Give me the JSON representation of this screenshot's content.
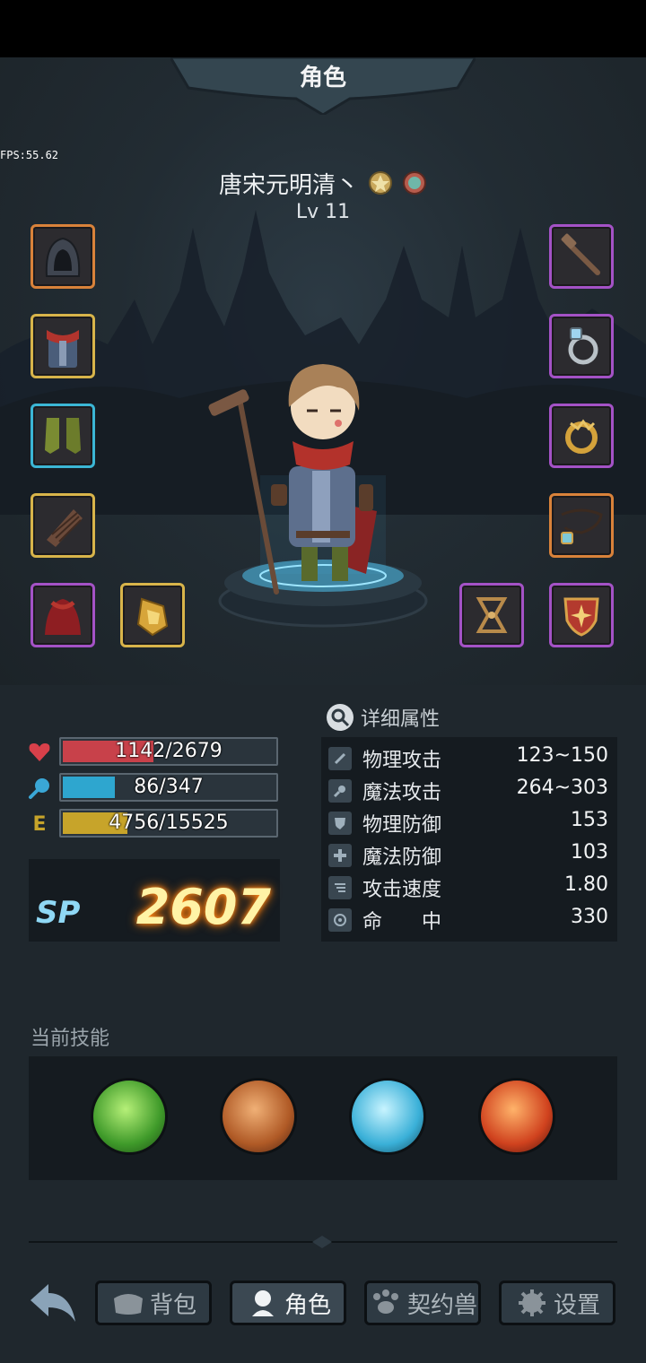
{
  "header": {
    "title": "角色",
    "fps": "FPS:55.62"
  },
  "character": {
    "name": "唐宋元明清丶",
    "level": "Lv 11"
  },
  "equipment": {
    "left": [
      "hood-icon",
      "red-scarf-armor-icon",
      "green-boots-icon",
      "leather-bracer-icon",
      "red-cape-icon",
      "gold-gem-icon"
    ],
    "right": [
      "wooden-staff-icon",
      "silver-ring-icon",
      "gold-ring-icon",
      "necklace-icon",
      "trinket-icon",
      "shield-icon"
    ]
  },
  "stats": {
    "hp": {
      "text": "1142/2679",
      "value": 1142,
      "max": 2679,
      "color": "#c8414a"
    },
    "mp": {
      "text": "86/347",
      "value": 86,
      "max": 347,
      "color": "#2ea6cf"
    },
    "exp": {
      "label": "E",
      "text": "4756/15525",
      "value": 4756,
      "max": 15525,
      "color": "#c7a42a"
    }
  },
  "sp": {
    "label": "SP",
    "value": "2607"
  },
  "attributes": {
    "title": "详细属性",
    "rows": [
      {
        "name": "物理攻击",
        "value": "123~150"
      },
      {
        "name": "魔法攻击",
        "value": "264~303"
      },
      {
        "name": "物理防御",
        "value": "153"
      },
      {
        "name": "魔法防御",
        "value": "103"
      },
      {
        "name": "攻击速度",
        "value": "1.80"
      },
      {
        "name": "命　　中",
        "value": "330"
      }
    ]
  },
  "skills": {
    "title": "当前技能",
    "items": [
      "wind-skill-icon",
      "earth-golem-skill-icon",
      "ice-crystal-skill-icon",
      "fire-rose-skill-icon"
    ]
  },
  "nav": {
    "back": "back-arrow-icon",
    "items": [
      {
        "label": "背包",
        "active": false
      },
      {
        "label": "角色",
        "active": true
      },
      {
        "label": "契约兽",
        "active": false
      },
      {
        "label": "设置",
        "active": false
      }
    ]
  }
}
